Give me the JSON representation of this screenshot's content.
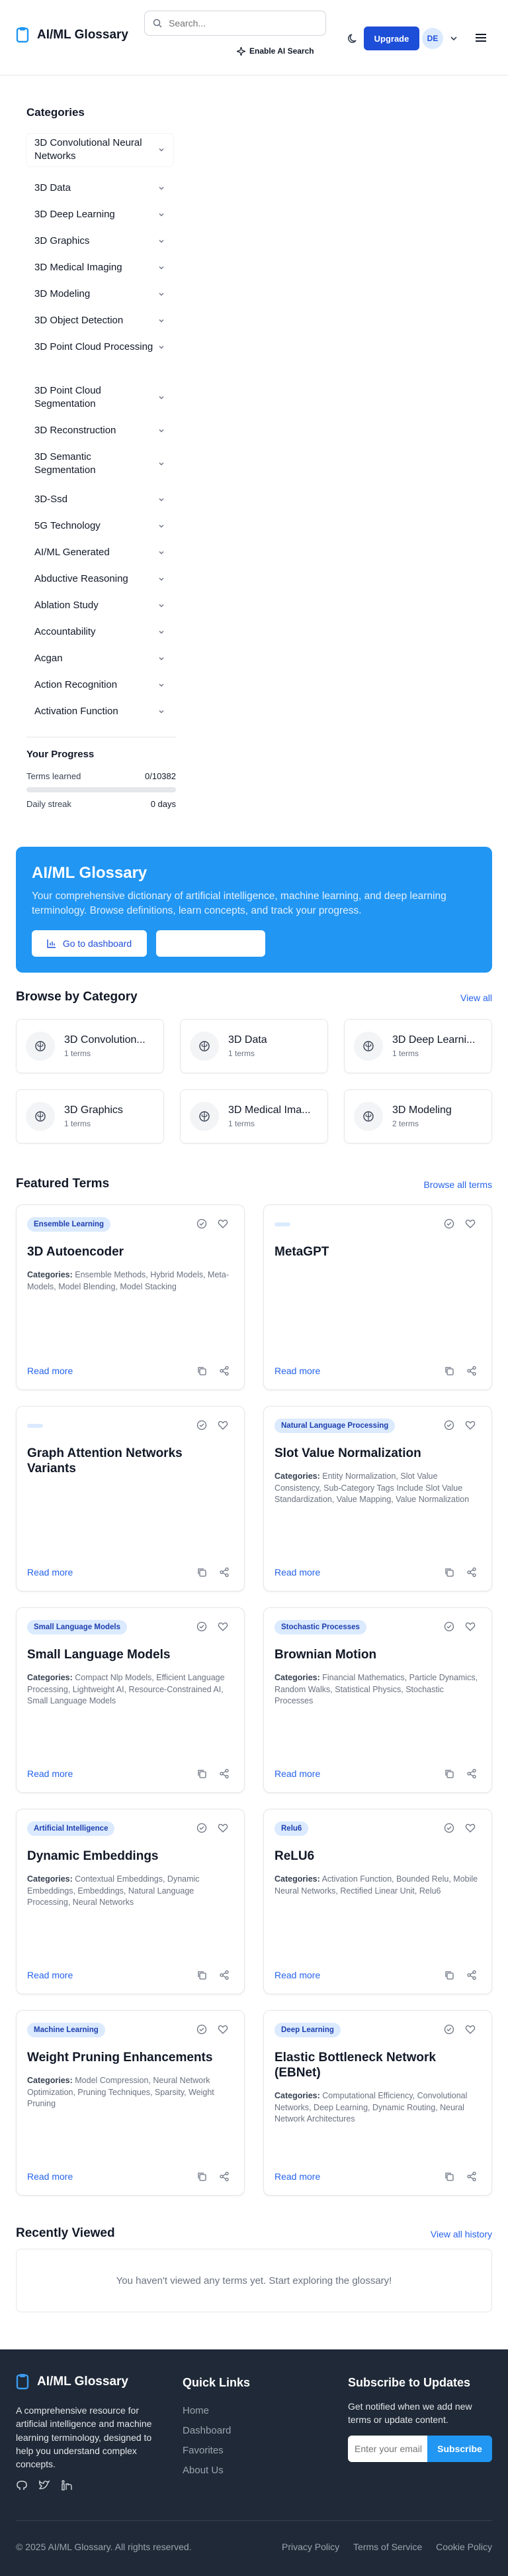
{
  "header": {
    "title": "AI/ML Glossary",
    "search_placeholder": "Search...",
    "ai_search": "Enable AI Search",
    "upgrade": "Upgrade",
    "avatar": "DE"
  },
  "sidebar": {
    "heading": "Categories",
    "categories": [
      "3D Convolutional Neural Networks",
      "3D Data",
      "3D Deep Learning",
      "3D Graphics",
      "3D Medical Imaging",
      "3D Modeling",
      "3D Object Detection",
      "3D Point Cloud Processing",
      "3D Point Cloud Segmentation",
      "3D Reconstruction",
      "3D Semantic Segmentation",
      "3D-Ssd",
      "5G Technology",
      "AI/ML Generated",
      "Abductive Reasoning",
      "Ablation Study",
      "Accountability",
      "Acgan",
      "Action Recognition",
      "Activation Function"
    ],
    "progress": {
      "heading": "Your Progress",
      "terms_label": "Terms learned",
      "terms_value": "0/10382",
      "terms_fraction": 0,
      "streak_label": "Daily streak",
      "streak_value": "0 days"
    }
  },
  "hero": {
    "title": "AI/ML Glossary",
    "description": "Your comprehensive dictionary of artificial intelligence, machine learning, and deep learning terminology. Browse definitions, learn concepts, and track your progress.",
    "dashboard_button": "Go to dashboard",
    "second_button": ""
  },
  "browse": {
    "heading": "Browse by Category",
    "view_all": "View all",
    "items": [
      {
        "name": "3D Convolution...",
        "count": "1 terms"
      },
      {
        "name": "3D Data",
        "count": "1 terms"
      },
      {
        "name": "3D Deep Learni...",
        "count": "1 terms"
      },
      {
        "name": "3D Graphics",
        "count": "1 terms"
      },
      {
        "name": "3D Medical Ima...",
        "count": "1 terms"
      },
      {
        "name": "3D Modeling",
        "count": "2 terms"
      }
    ]
  },
  "featured": {
    "heading": "Featured Terms",
    "browse_all": "Browse all terms",
    "categories_label": "Categories:",
    "read_more": "Read more",
    "cards": [
      {
        "badge": "Ensemble Learning",
        "title": "3D Autoencoder",
        "categories": "Ensemble Methods, Hybrid Models, Meta-Models, Model Blending, Model Stacking"
      },
      {
        "badge": "",
        "title": "MetaGPT",
        "categories": ""
      },
      {
        "badge": "",
        "title": "Graph Attention Networks Variants",
        "categories": ""
      },
      {
        "badge": "Natural Language Processing",
        "title": "Slot Value Normalization",
        "categories": "Entity Normalization, Slot Value Consistency, Sub-Category Tags Include Slot Value Standardization, Value Mapping, Value Normalization"
      },
      {
        "badge": "Small Language Models",
        "title": "Small Language Models",
        "categories": "Compact Nlp Models, Efficient Language Processing, Lightweight AI, Resource-Constrained AI, Small Language Models"
      },
      {
        "badge": "Stochastic Processes",
        "title": "Brownian Motion",
        "categories": "Financial Mathematics, Particle Dynamics, Random Walks, Statistical Physics, Stochastic Processes"
      },
      {
        "badge": "Artificial Intelligence",
        "title": "Dynamic Embeddings",
        "categories": "Contextual Embeddings, Dynamic Embeddings, Embeddings, Natural Language Processing, Neural Networks"
      },
      {
        "badge": "Relu6",
        "title": "ReLU6",
        "categories": "Activation Function, Bounded Relu, Mobile Neural Networks, Rectified Linear Unit, Relu6"
      },
      {
        "badge": "Machine Learning",
        "title": "Weight Pruning Enhancements",
        "categories": "Model Compression, Neural Network Optimization, Pruning Techniques, Sparsity, Weight Pruning"
      },
      {
        "badge": "Deep Learning",
        "title": "Elastic Bottleneck Network (EBNet)",
        "categories": "Computational Efficiency, Convolutional Networks, Deep Learning, Dynamic Routing, Neural Network Architectures"
      }
    ]
  },
  "recent": {
    "heading": "Recently Viewed",
    "view_all": "View all history",
    "empty": "You haven't viewed any terms yet. Start exploring the glossary!"
  },
  "footer": {
    "title": "AI/ML Glossary",
    "description": "A comprehensive resource for artificial intelligence and machine learning terminology, designed to help you understand complex concepts.",
    "quick_links_heading": "Quick Links",
    "quick_links": [
      "Home",
      "Dashboard",
      "Favorites",
      "About Us"
    ],
    "subscribe_heading": "Subscribe to Updates",
    "subscribe_desc": "Get notified when we add new terms or update content.",
    "email_placeholder": "Enter your email",
    "subscribe_button": "Subscribe",
    "copyright": "© 2025 AI/ML Glossary. All rights reserved.",
    "legal": [
      "Privacy Policy",
      "Terms of Service",
      "Cookie Policy"
    ]
  },
  "colors": {
    "primary": "#2196f3",
    "upgrade": "#1d4ed8",
    "link": "#2563eb",
    "footer_bg": "#1f2937"
  }
}
